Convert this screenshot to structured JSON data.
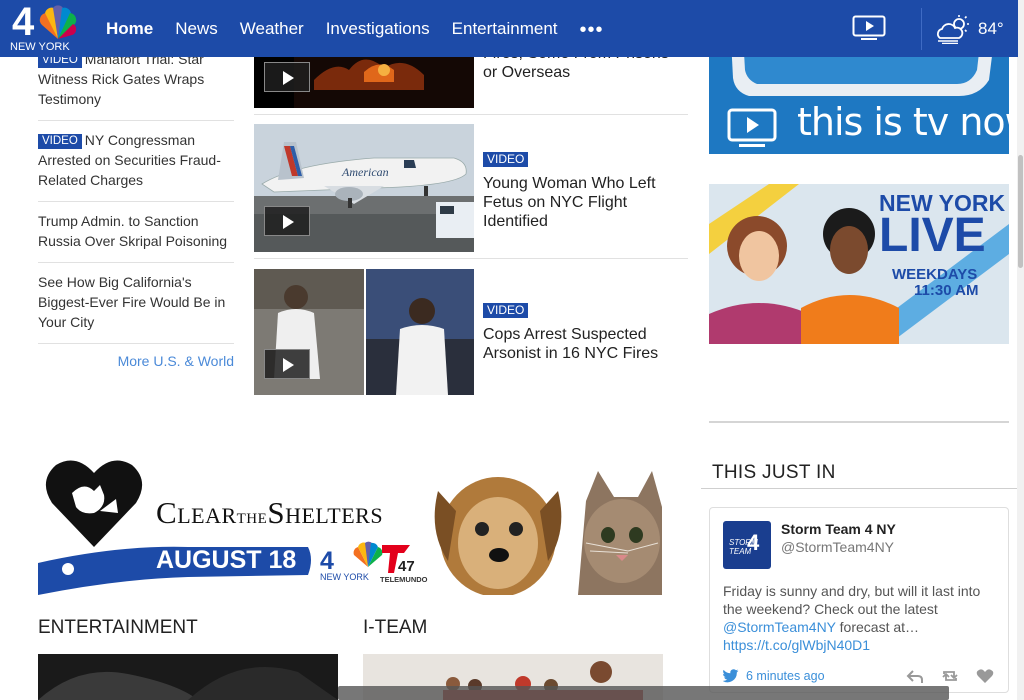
{
  "nav": {
    "logo_numeral": "4",
    "logo_city": "NEW YORK",
    "items": [
      {
        "label": "Home",
        "active": true
      },
      {
        "label": "News",
        "active": false
      },
      {
        "label": "Weather",
        "active": false
      },
      {
        "label": "Investigations",
        "active": false
      },
      {
        "label": "Entertainment",
        "active": false
      }
    ],
    "more_label": "•••",
    "tv_icon": "tv-play-icon",
    "weather_icon": "partly-cloudy-icon",
    "temperature": "84°"
  },
  "left_stories": [
    {
      "badge": "VIDEO",
      "text": "Manafort Trial: Star Witness Rick Gates Wraps Testimony"
    },
    {
      "badge": "VIDEO",
      "text": "NY Congressman Arrested on Securities Fraud-Related Charges"
    },
    {
      "badge": "",
      "text": "Trump Admin. to Sanction Russia Over Skripal Poisoning"
    },
    {
      "badge": "",
      "text": "See How Big California's Biggest-Ever Fire Would Be in Your City"
    }
  ],
  "more_link": "More U.S. & World",
  "mid_stories": [
    {
      "badge": "",
      "text": "Fires, Some From Prisons or Overseas"
    },
    {
      "badge": "VIDEO",
      "text": "Young Woman Who Left Fetus on NYC Flight Identified"
    },
    {
      "badge": "VIDEO",
      "text": "Cops Arrest Suspected Arsonist in 16 NYC Fires"
    }
  ],
  "mid_images": {
    "plane_livery": "American"
  },
  "ad_tv": {
    "text": "this is tv now"
  },
  "ad_nylive": {
    "line1": "NEW YORK",
    "line2": "LIVE",
    "line3": "WEEKDAYS",
    "line4": "11:30 AM"
  },
  "this_just_in": {
    "heading": "THIS JUST IN",
    "tweet": {
      "name": "Storm Team 4 NY",
      "handle": "@StormTeam4NY",
      "avatar_text": "STORM TEAM",
      "avatar_numeral": "4",
      "body_text": "Friday is sunny and dry, but will it last into the weekend? Check out the latest ",
      "mention": "@StormTeam4NY",
      "body_tail": " forecast at…",
      "url": "https://t.co/glWbjN40D1",
      "time": "6 minutes ago"
    }
  },
  "banner": {
    "title_a": "C",
    "title_b": "LEAR",
    "title_c": "THE",
    "title_d": "S",
    "title_e": "HELTERS",
    "date": "AUGUST 18",
    "nbc_numeral": "4",
    "nbc_city": "NEW YORK",
    "telemundo_numeral": "47",
    "telemundo": "TELEMUNDO"
  },
  "sections": {
    "entertainment": "ENTERTAINMENT",
    "iteam": "I-TEAM"
  },
  "colors": {
    "brand_blue": "#1d4ba8",
    "link_blue": "#3b8fd9"
  }
}
